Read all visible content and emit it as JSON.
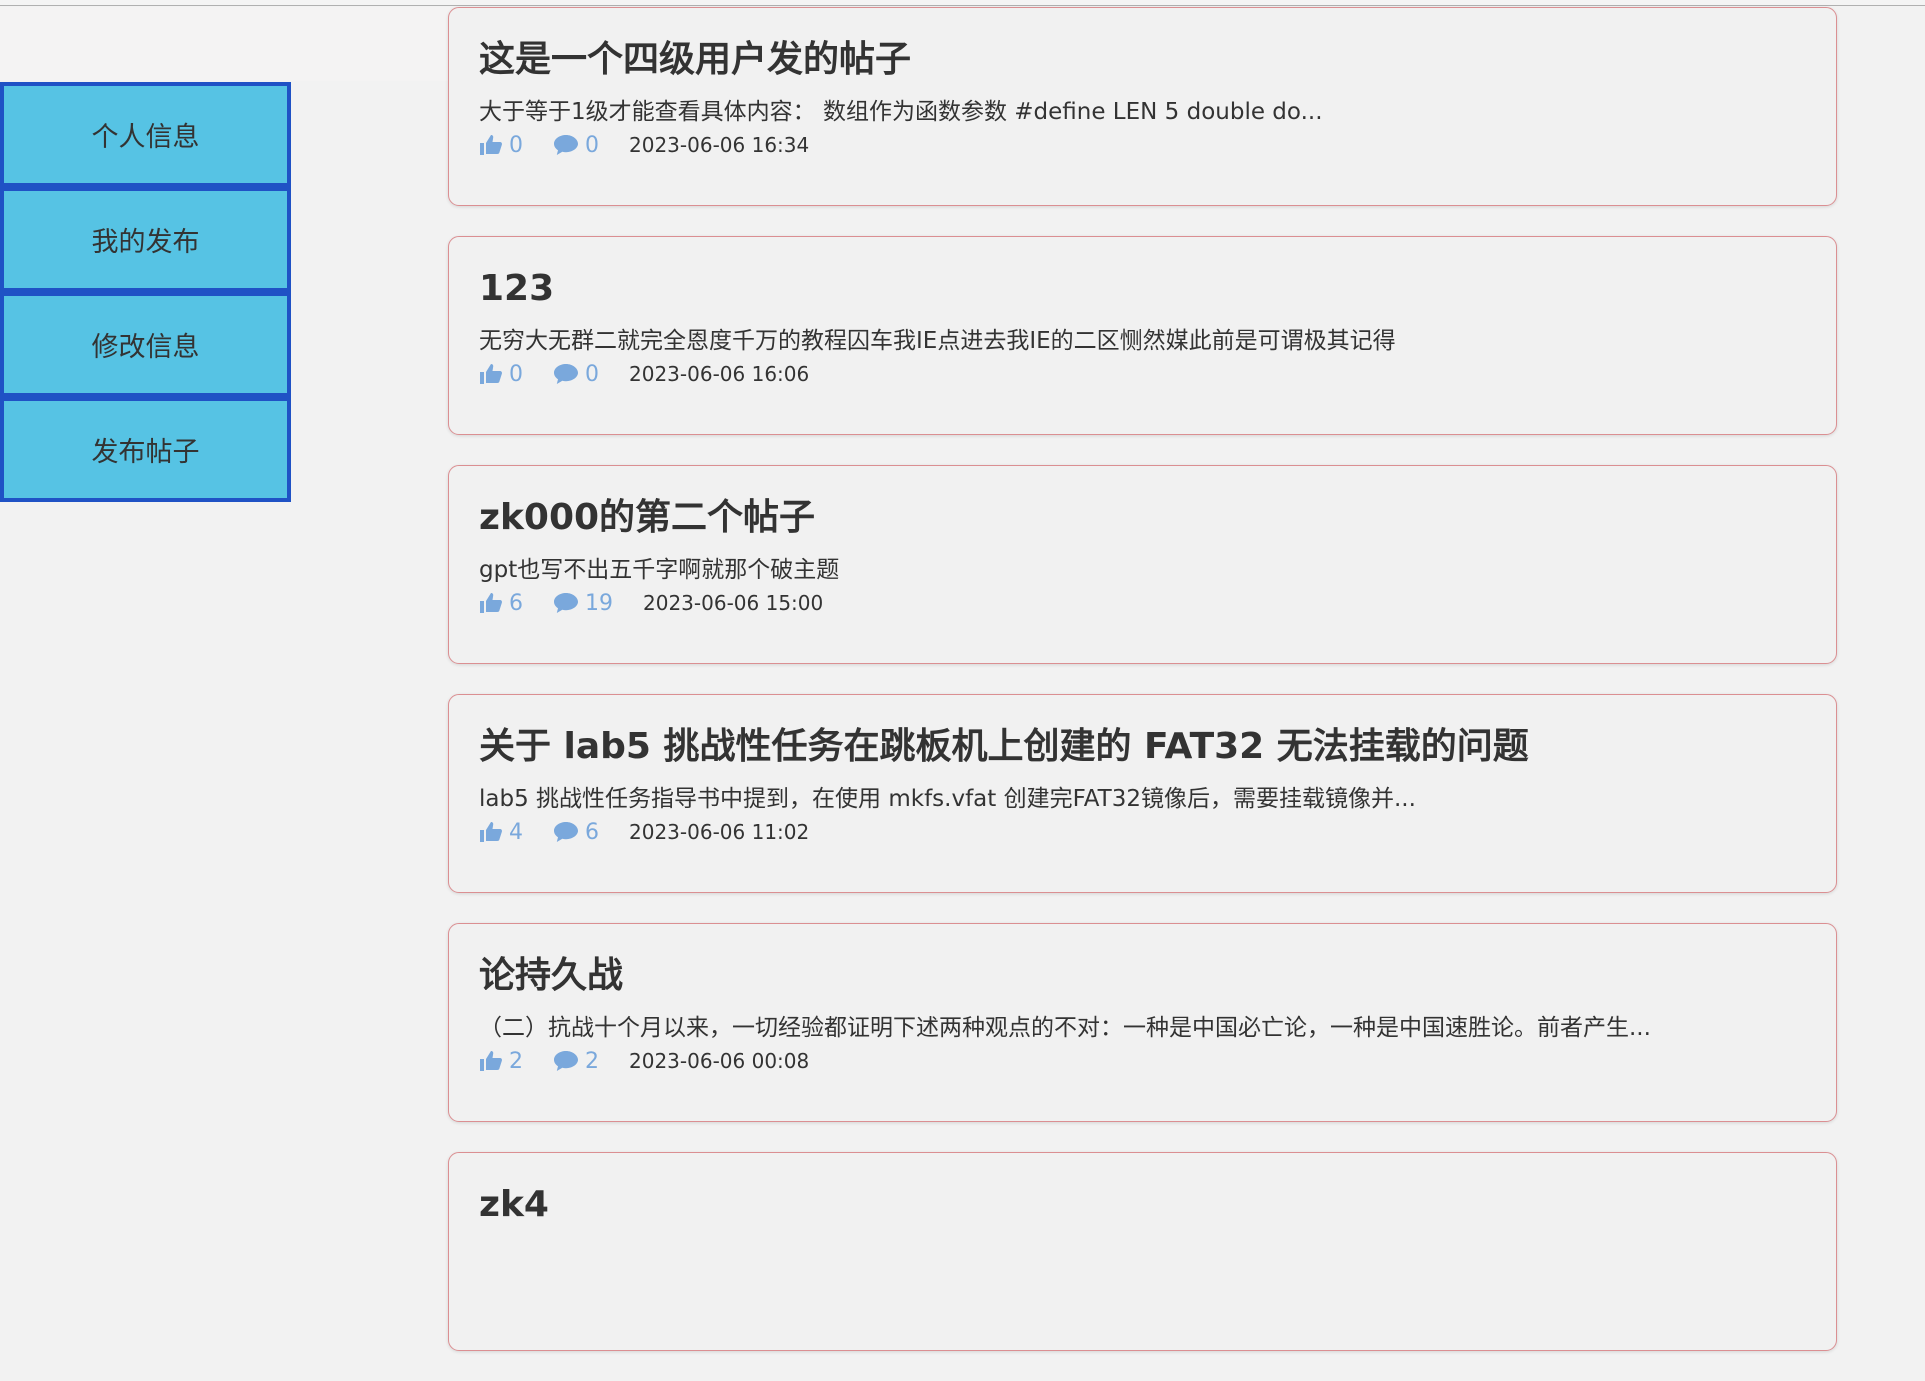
{
  "sidebar": {
    "items": [
      {
        "label": "个人信息"
      },
      {
        "label": "我的发布"
      },
      {
        "label": "修改信息"
      },
      {
        "label": "发布帖子"
      }
    ]
  },
  "posts": [
    {
      "title": "这是一个四级用户发的帖子",
      "excerpt": "大于等于1级才能查看具体内容：  数组作为函数参数 #define LEN 5 double do...",
      "likes": "0",
      "comments": "0",
      "time": "2023-06-06 16:34"
    },
    {
      "title": "123",
      "excerpt": "无穷大无群二就完全恩度千万的教程囚车我IE点进去我IE的二区恻然媒此前是可谓极其记得",
      "likes": "0",
      "comments": "0",
      "time": "2023-06-06 16:06"
    },
    {
      "title": "zk000的第二个帖子",
      "excerpt": "gpt也写不出五千字啊就那个破主题",
      "likes": "6",
      "comments": "19",
      "time": "2023-06-06 15:00"
    },
    {
      "title": "关于 lab5 挑战性任务在跳板机上创建的 FAT32 无法挂载的问题",
      "excerpt": "lab5 挑战性任务指导书中提到，在使用 mkfs.vfat 创建完FAT32镜像后，需要挂载镜像并...",
      "likes": "4",
      "comments": "6",
      "time": "2023-06-06 11:02"
    },
    {
      "title": "论持久战",
      "excerpt": "（二）抗战十个月以来，一切经验都证明下述两种观点的不对：一种是中国必亡论，一种是中国速胜论。前者产生...",
      "likes": "2",
      "comments": "2",
      "time": "2023-06-06 00:08"
    },
    {
      "title": "zk4",
      "excerpt": "",
      "likes": "",
      "comments": "",
      "time": ""
    }
  ],
  "icons": {
    "like": "thumbs-up-icon",
    "comment": "comment-bubble-icon"
  },
  "colors": {
    "sidebar_bg": "#56c3e4",
    "sidebar_border": "#1f52c5",
    "card_border": "#db8f92",
    "meta_icon": "#7aa8dc",
    "page_bg": "#f2f2f2"
  }
}
